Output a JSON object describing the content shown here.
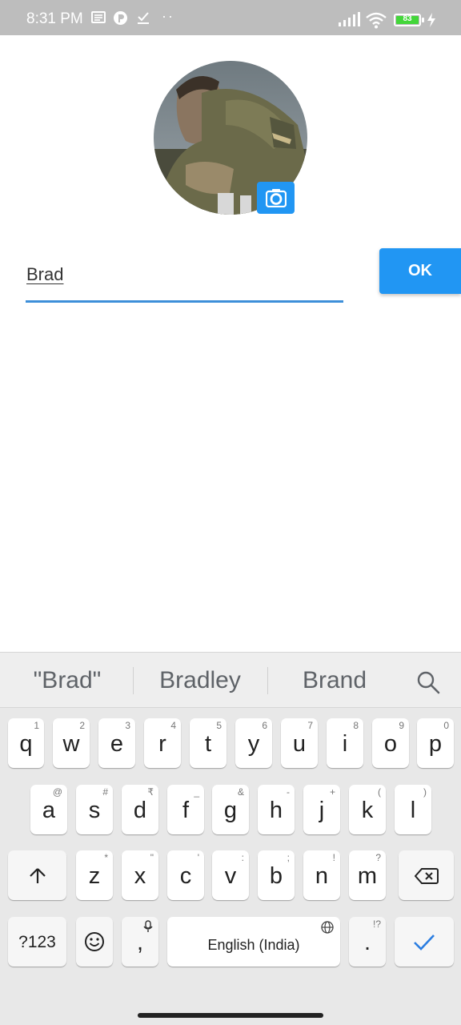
{
  "status_bar": {
    "time": "8:31 PM",
    "battery": "83",
    "icons": [
      "message-icon",
      "p-app-icon",
      "download-done-icon",
      "more-dots-icon",
      "signal-icon",
      "wifi-icon",
      "battery-icon",
      "charging-icon"
    ]
  },
  "profile": {
    "name_value": "Brad",
    "ok_label": "OK",
    "accent_color": "#2196f3"
  },
  "keyboard": {
    "suggestions": [
      "\"Brad\"",
      "Bradley",
      "Brand"
    ],
    "row1": [
      [
        "q",
        "1"
      ],
      [
        "w",
        "2"
      ],
      [
        "e",
        "3"
      ],
      [
        "r",
        "4"
      ],
      [
        "t",
        "5"
      ],
      [
        "y",
        "6"
      ],
      [
        "u",
        "7"
      ],
      [
        "i",
        "8"
      ],
      [
        "o",
        "9"
      ],
      [
        "p",
        "0"
      ]
    ],
    "row2": [
      [
        "a",
        "@"
      ],
      [
        "s",
        "#"
      ],
      [
        "d",
        "₹"
      ],
      [
        "f",
        "_"
      ],
      [
        "g",
        "&"
      ],
      [
        "h",
        "-"
      ],
      [
        "j",
        "+"
      ],
      [
        "k",
        "("
      ],
      [
        "l",
        ")"
      ]
    ],
    "row3": [
      [
        "z",
        "*"
      ],
      [
        "x",
        "\""
      ],
      [
        "c",
        "'"
      ],
      [
        "v",
        ":"
      ],
      [
        "b",
        ";"
      ],
      [
        "n",
        "!"
      ],
      [
        "m",
        "?"
      ]
    ],
    "symbols_label": "?123",
    "comma_label": ",",
    "space_label": "English (India)",
    "period_label": ".",
    "period_hint": "!?"
  }
}
